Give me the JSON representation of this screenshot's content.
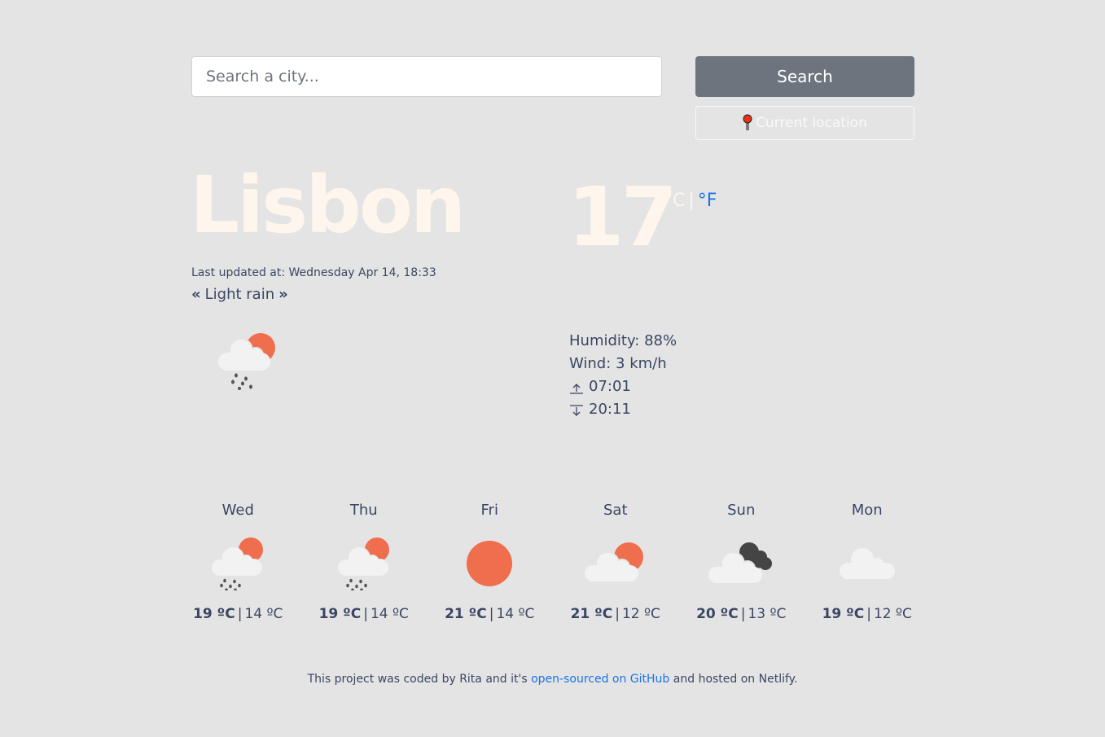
{
  "search": {
    "placeholder": "Search a city...",
    "value": "",
    "button_label": "Search",
    "location_button_label": "Current location",
    "location_icon": "round-pushpin-icon"
  },
  "current": {
    "city": "Lisbon",
    "temperature": "17",
    "unit_celsius": "°C",
    "unit_separator": "|",
    "unit_fahrenheit": "°F",
    "active_unit": "celsius",
    "last_updated": "Last updated at: Wednesday Apr 14, 18:33",
    "description": "Light rain",
    "icon": "light-rain-partly-sunny-icon",
    "humidity": "Humidity: 88%",
    "wind": "Wind: 3 km/h",
    "sunrise": "07:01",
    "sunset": "20:11"
  },
  "forecast": [
    {
      "day": "Wed",
      "icon": "rain-partly-sunny-icon",
      "max": "19 ºC",
      "min": "14 ºC"
    },
    {
      "day": "Thu",
      "icon": "rain-partly-sunny-icon",
      "max": "19 ºC",
      "min": "14 ºC"
    },
    {
      "day": "Fri",
      "icon": "sun-icon",
      "max": "21 ºC",
      "min": "14 ºC"
    },
    {
      "day": "Sat",
      "icon": "partly-cloudy-icon",
      "max": "21 ºC",
      "min": "12 ºC"
    },
    {
      "day": "Sun",
      "icon": "broken-clouds-icon",
      "max": "20 ºC",
      "min": "13 ºC"
    },
    {
      "day": "Mon",
      "icon": "cloud-icon",
      "max": "19 ºC",
      "min": "12 ºC"
    }
  ],
  "footer": {
    "prefix": "This project was coded by Rita and it's ",
    "link_text": "open-sourced on GitHub",
    "suffix": " and hosted on Netlify."
  },
  "colors": {
    "background": "#e4e4e4",
    "text": "#3a4663",
    "heading": "#fef5ec",
    "accent_link": "#1a73e8",
    "sun": "#ee6e4e",
    "cloud": "#f2f2f2",
    "dark_cloud": "#444444",
    "button": "#6c757d"
  }
}
